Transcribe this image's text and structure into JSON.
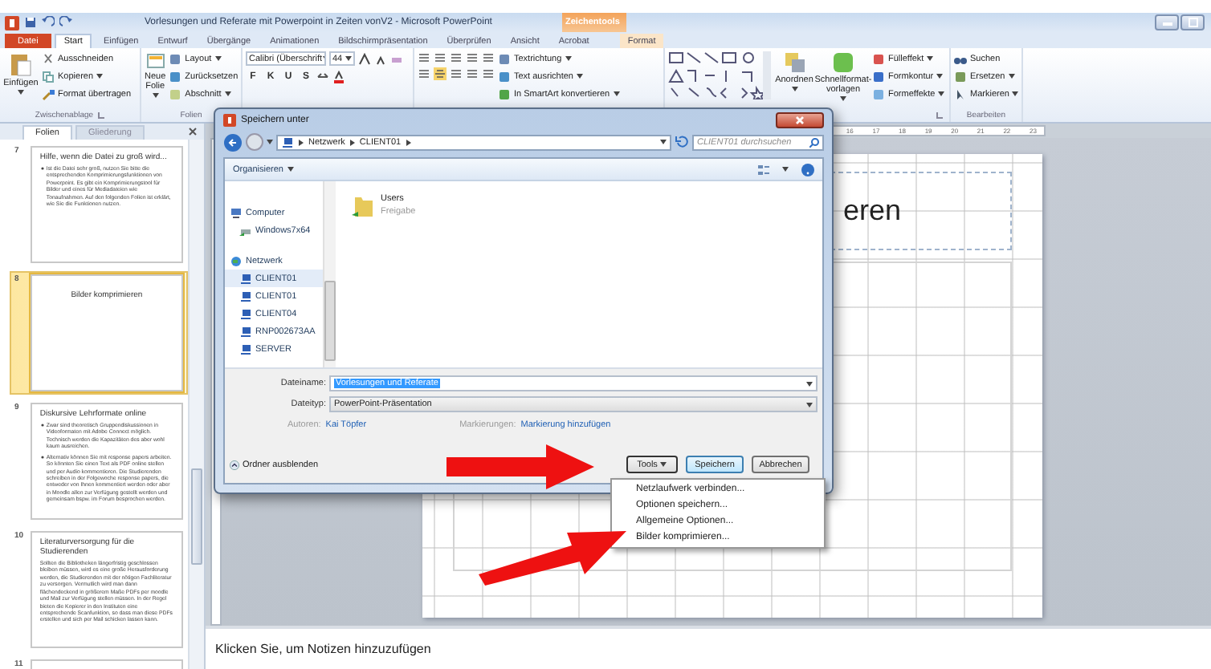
{
  "window": {
    "title": "Vorlesungen und Referate mit Powerpoint in Zeiten vonV2 - Microsoft PowerPoint",
    "contextual_tab": "Zeichentools"
  },
  "ribbon_tabs": [
    {
      "label": "Datei",
      "kind": "file",
      "selected": false
    },
    {
      "label": "Start",
      "kind": "tab",
      "selected": true
    },
    {
      "label": "Einfügen",
      "kind": "tab",
      "selected": false
    },
    {
      "label": "Entwurf",
      "kind": "tab",
      "selected": false
    },
    {
      "label": "Übergänge",
      "kind": "tab",
      "selected": false
    },
    {
      "label": "Animationen",
      "kind": "tab",
      "selected": false
    },
    {
      "label": "Bildschirmpräsentation",
      "kind": "tab",
      "selected": false
    },
    {
      "label": "Überprüfen",
      "kind": "tab",
      "selected": false
    },
    {
      "label": "Ansicht",
      "kind": "tab",
      "selected": false
    },
    {
      "label": "Acrobat",
      "kind": "tab",
      "selected": false
    },
    {
      "label": "Format",
      "kind": "contextual",
      "selected": false
    }
  ],
  "ribbon": {
    "clipboard": {
      "label": "Zwischenablage",
      "paste": "Einfügen",
      "cut": "Ausschneiden",
      "copy": "Kopieren",
      "format_painter": "Format übertragen"
    },
    "slides": {
      "label": "Folien",
      "new_slide": "Neue Folie",
      "layout": "Layout",
      "reset": "Zurücksetzen",
      "section": "Abschnitt"
    },
    "font": {
      "name": "Calibri (Überschrift",
      "size": "44",
      "style_buttons": [
        "F",
        "K",
        "U",
        "S"
      ]
    },
    "paragraph": {
      "text_direction": "Textrichtung",
      "align_text": "Text ausrichten",
      "smartart": "In SmartArt konvertieren"
    },
    "drawing": {
      "arrange": "Anordnen",
      "quick_styles": "Schnellformat-vorlagen",
      "fill": "Fülleffekt",
      "outline": "Formkontur",
      "effects": "Formeffekte"
    },
    "editing": {
      "label": "Bearbeiten",
      "find": "Suchen",
      "replace": "Ersetzen",
      "select": "Markieren"
    }
  },
  "pane_tabs": [
    {
      "label": "Folien",
      "selected": true
    },
    {
      "label": "Gliederung",
      "selected": false
    }
  ],
  "thumbnails": [
    {
      "number": "7",
      "selected": false,
      "title": "Hilfe, wenn die Datei zu groß wird...",
      "bulleted": true,
      "body": [
        "Ist die Datei sehr groß, nutzen Sie bitte die entsprechenden Komprimierungsfunktionen von Powerpoint. Es gibt ein Komprimierungstool für Bilder und eines für Mediadateien wie Tonaufnahmen. Auf den folgenden Folien ist erklärt, wie Sie die Funktionen nutzen."
      ]
    },
    {
      "number": "8",
      "selected": true,
      "title": "Bilder komprimieren"
    },
    {
      "number": "9",
      "selected": false,
      "title": "Diskursive Lehrformate online",
      "bulleted": true,
      "body": [
        "Zwar sind theoretisch Gruppendiskussionen in Videoformaten mit Adobe Connect möglich. Technisch werden die Kapazitäten des aber wohl kaum ausreichen.",
        "Alternativ können Sie mit response papers arbeiten. So könnten Sie einen Text als PDF online stellen und per Audio kommentieren. Die Studierenden schreiben in der Folgewoche response papers, die entweder von Ihnen kommentiert werden oder aber in Moodle allen zur Verfügung gestellt werden und gemeinsam bspw. im Forum besprochen werden."
      ]
    },
    {
      "number": "10",
      "selected": false,
      "title": "Literaturversorgung für die Studierenden",
      "body": [
        "Sollten die Bibliotheken längerfristig geschlossen bleiben müssen, wird es eine große Herausforderung werden, die Studierenden mit der nötigen Fachliteratur zu versorgen. Vermutlich wird man dann flächendeckend in größerem Maße PDFs per moodle und Mail zur Verfügung stellen müssen. In der Regel bieten die Kopierer in den Instituten eine entsprechende Scanfunktion, so dass man diese PDFs erstellen und sich per Mail schicken lassen kann."
      ]
    },
    {
      "number": "11",
      "selected": false
    }
  ],
  "ruler_marks": [
    "16",
    "17",
    "18",
    "19",
    "20",
    "21",
    "22",
    "23"
  ],
  "slide": {
    "title_visible": "eren"
  },
  "notes": {
    "placeholder": "Klicken Sie, um Notizen hinzuzufügen"
  },
  "dialog": {
    "title": "Speichern unter",
    "breadcrumb": [
      "Netzwerk",
      "CLIENT01"
    ],
    "search_placeholder": "CLIENT01 durchsuchen",
    "organize": "Organisieren",
    "nav": [
      {
        "label": "Computer",
        "kind": "computer",
        "selected": false,
        "children": [
          {
            "label": "Windows7x64",
            "kind": "drive",
            "selected": false
          }
        ]
      },
      {
        "label": "Netzwerk",
        "kind": "network",
        "selected": false,
        "children": [
          {
            "label": "CLIENT01",
            "kind": "host",
            "selected": true
          },
          {
            "label": "CLIENT01",
            "kind": "host",
            "selected": false
          },
          {
            "label": "CLIENT04",
            "kind": "host",
            "selected": false
          },
          {
            "label": "RNP002673AA",
            "kind": "host",
            "selected": false
          },
          {
            "label": "SERVER",
            "kind": "host",
            "selected": false
          }
        ]
      }
    ],
    "files": [
      {
        "name": "Users",
        "type": "Freigabe"
      }
    ],
    "filename_label": "Dateiname:",
    "filename": "Vorlesungen und Referate",
    "filetype_label": "Dateityp:",
    "filetype": "PowerPoint-Präsentation",
    "authors_label": "Autoren:",
    "authors": "Kai Töpfer",
    "tags_label": "Markierungen:",
    "tags": "Markierung hinzufügen",
    "hide_folders": "Ordner ausblenden",
    "buttons": [
      {
        "label": "Tools",
        "kind": "menu"
      },
      {
        "label": "Speichern",
        "kind": "default"
      },
      {
        "label": "Abbrechen",
        "kind": "plain"
      }
    ]
  },
  "tools_menu": [
    "Netzlaufwerk verbinden...",
    "Optionen speichern...",
    "Allgemeine Optionen...",
    "Bilder komprimieren..."
  ]
}
